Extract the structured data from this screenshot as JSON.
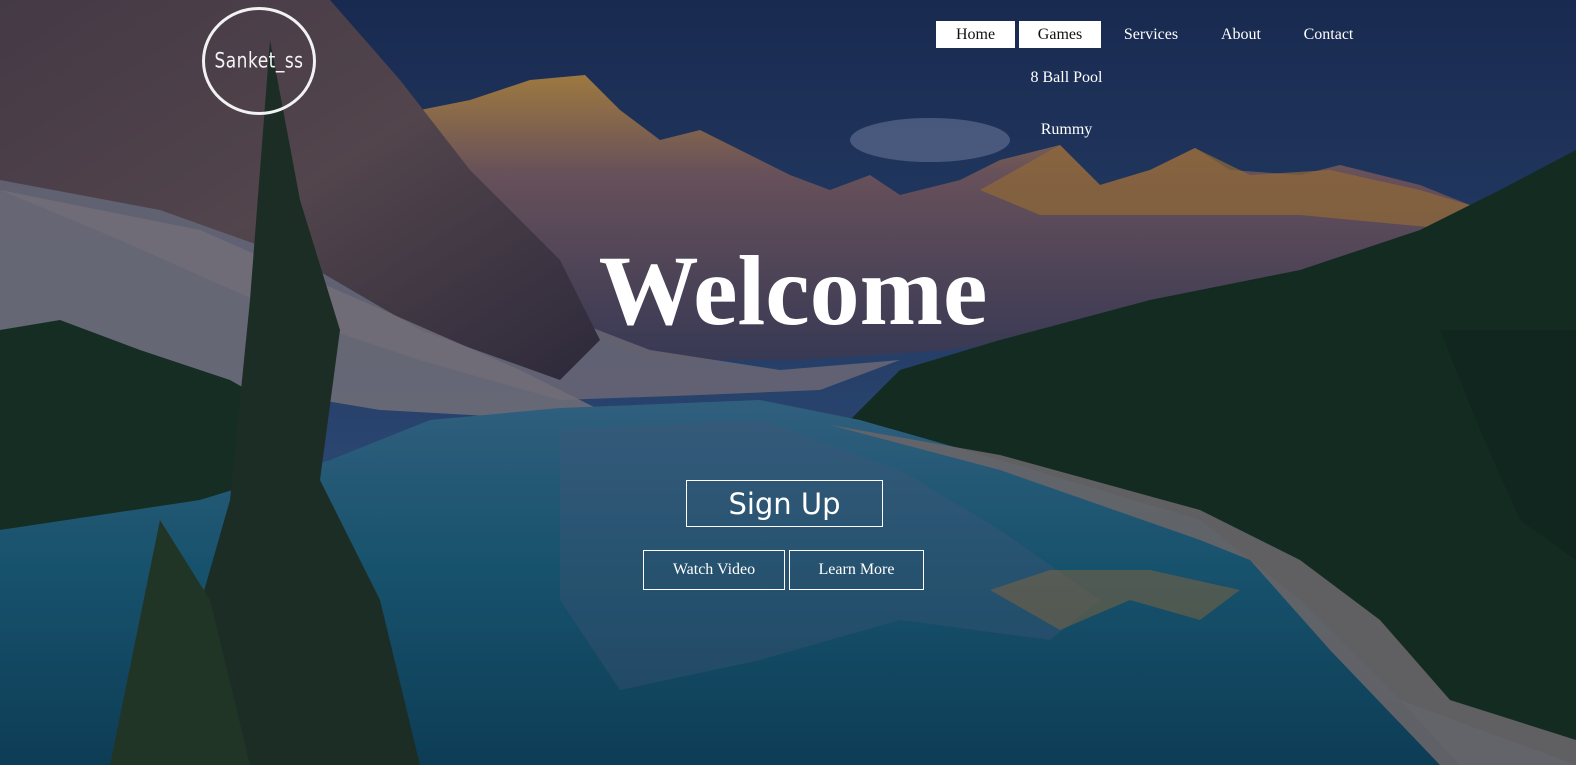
{
  "logo": {
    "text": "Sanket_ss"
  },
  "nav": {
    "home": "Home",
    "games": "Games",
    "services": "Services",
    "about": "About",
    "contact": "Contact"
  },
  "games_menu": {
    "items": [
      "8 Ball Pool",
      "Rummy"
    ]
  },
  "hero": {
    "title": "Welcome",
    "signup_label": "Sign Up",
    "watch_video_label": "Watch Video",
    "learn_more_label": "Learn More"
  },
  "colors": {
    "sky": "#2d4a78",
    "lake": "#1b6a84",
    "forest": "#14311f",
    "peaks_lit": "#d9a13c"
  }
}
